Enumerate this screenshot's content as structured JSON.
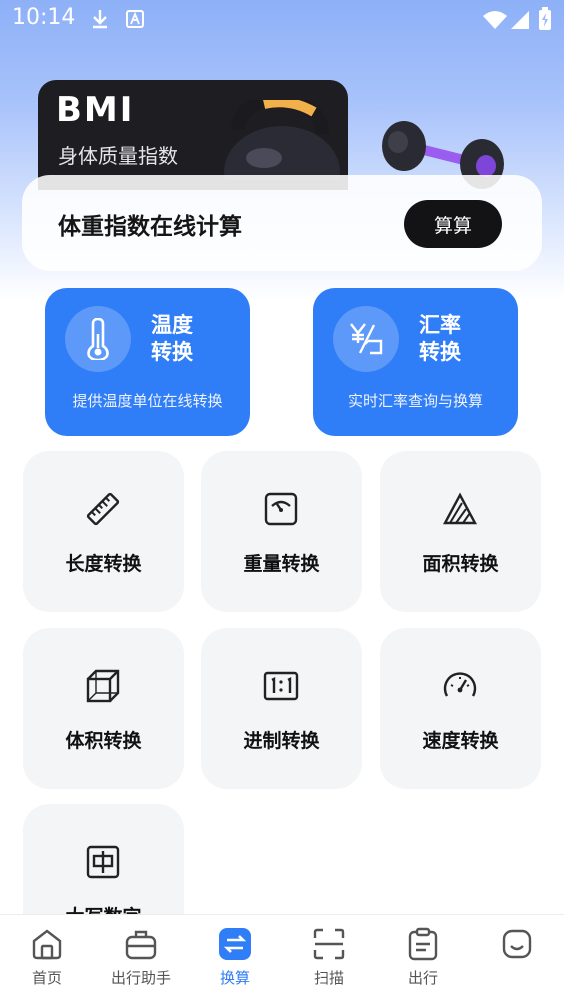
{
  "status_bar": {
    "time": "10:14"
  },
  "bmi": {
    "title": "BMI",
    "subtitle": "身体质量指数",
    "panel_text": "体重指数在线计算",
    "button": "算算"
  },
  "feature_cards": [
    {
      "title": "温度转换",
      "desc": "提供温度单位在线转换",
      "icon": "thermometer-icon"
    },
    {
      "title": "汇率转换",
      "desc": "实时汇率查询与换算",
      "icon": "currency-exchange-icon"
    }
  ],
  "tools": [
    {
      "label": "长度转换",
      "icon": "ruler-icon"
    },
    {
      "label": "重量转换",
      "icon": "scale-icon"
    },
    {
      "label": "面积转换",
      "icon": "area-icon"
    },
    {
      "label": "体积转换",
      "icon": "cube-icon"
    },
    {
      "label": "进制转换",
      "icon": "ratio-icon"
    },
    {
      "label": "速度转换",
      "icon": "speedometer-icon"
    },
    {
      "label": "大写数字",
      "icon": "chinese-char-icon"
    }
  ],
  "nav": [
    {
      "label": "首页",
      "icon": "home-icon"
    },
    {
      "label": "出行助手",
      "icon": "luggage-icon"
    },
    {
      "label": "换算",
      "icon": "exchange-icon",
      "active": true
    },
    {
      "label": "扫描",
      "icon": "scan-icon"
    },
    {
      "label": "出行",
      "icon": "clipboard-icon"
    },
    {
      "label": "",
      "icon": "profile-icon"
    }
  ],
  "colors": {
    "accent": "#2f7df7",
    "banner_dark": "#1d1d22",
    "tile_bg": "#f4f5f7"
  }
}
